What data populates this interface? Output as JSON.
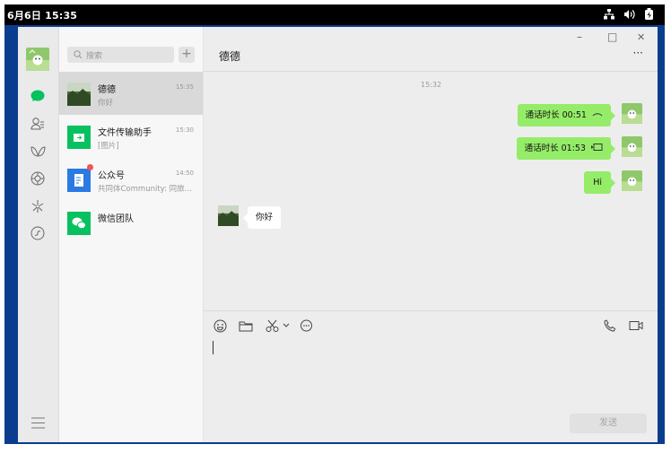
{
  "system_bar": {
    "clock": "6月6日 15:35"
  },
  "sidebar": {
    "avatar": "profile-avatar",
    "icons": [
      "chat-icon",
      "contacts-icon",
      "favorites-icon",
      "moments-icon",
      "discover-icon",
      "miniprogram-icon"
    ],
    "menu": "menu-icon"
  },
  "chat_list": {
    "search_placeholder": "搜索",
    "add_label": "+",
    "items": [
      {
        "name": "德德",
        "time": "15:35",
        "preview": "你好"
      },
      {
        "name": "文件传输助手",
        "time": "15:30",
        "preview": "[图片]"
      },
      {
        "name": "公众号",
        "time": "14:50",
        "preview": "共同体Community: 同旅…"
      },
      {
        "name": "微信团队",
        "time": "",
        "preview": ""
      }
    ]
  },
  "conversation": {
    "title": "德德",
    "more": "···",
    "window_controls": {
      "minimize": "–",
      "maximize": "□",
      "close": "✕"
    },
    "timestamp": "15:32",
    "messages": [
      {
        "side": "right",
        "text": "通话时长 00:51",
        "icon": "phone-hangup-icon"
      },
      {
        "side": "right",
        "text": "通话时长 01:53",
        "icon": "video-call-icon"
      },
      {
        "side": "right",
        "text": "Hi"
      },
      {
        "side": "left",
        "text": "你好"
      }
    ]
  },
  "composer": {
    "tools": [
      "emoji-icon",
      "folder-icon",
      "scissors-icon",
      "chevron-down-icon",
      "chat-history-icon"
    ],
    "voice_call": "phone-icon",
    "video_call": "video-icon",
    "send_label": "发送"
  },
  "colors": {
    "accent_green": "#95ec69",
    "app_green": "#07c160",
    "frame_blue": "#0a3d8f"
  }
}
